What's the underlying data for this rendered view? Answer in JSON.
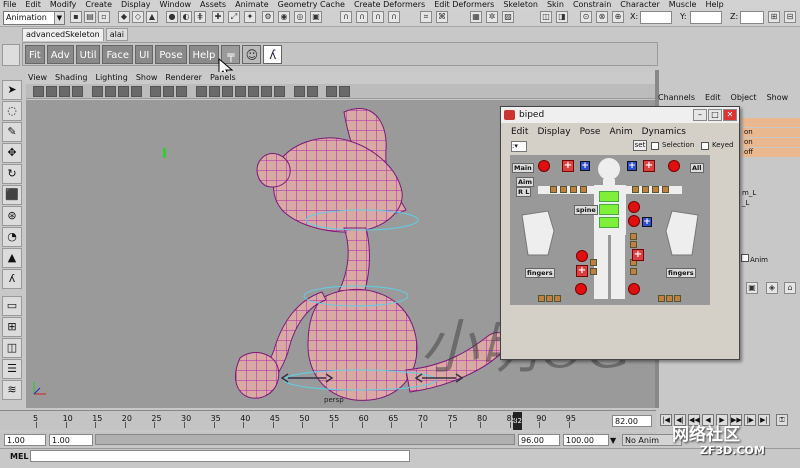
{
  "menubar": [
    "File",
    "Edit",
    "Modify",
    "Create",
    "Display",
    "Window",
    "Assets",
    "Animate",
    "Geometry Cache",
    "Create Deformers",
    "Edit Deformers",
    "Skeleton",
    "Skin",
    "Constrain",
    "Character",
    "Muscle",
    "Help"
  ],
  "mode": "Animation",
  "coords": {
    "x_label": "X:",
    "y_label": "Y:",
    "z_label": "Z:"
  },
  "shelf_tabs": [
    "advancedSkeleton",
    "alai"
  ],
  "shelf_buttons": [
    "Fit",
    "Adv",
    "Util",
    "Face",
    "UI",
    "Pose",
    "Help"
  ],
  "panel_menu": [
    "View",
    "Shading",
    "Lighting",
    "Show",
    "Renderer",
    "Panels"
  ],
  "viewport": {
    "camera_label": "persp",
    "watermark": "小明CG"
  },
  "channel_box": {
    "menu": [
      "Channels",
      "Edit",
      "Object",
      "Show"
    ],
    "values": [
      "",
      "on",
      "on",
      "off"
    ],
    "side_labels": [
      "m_L",
      "_L",
      "Anim"
    ]
  },
  "timeline": {
    "ticks": [
      "5",
      "10",
      "15",
      "20",
      "25",
      "30",
      "35",
      "40",
      "45",
      "50",
      "55",
      "60",
      "65",
      "70",
      "75",
      "80",
      "85",
      "90",
      "95"
    ],
    "current_frame": "82",
    "current_field": "82.00"
  },
  "range": {
    "start": "1.00",
    "playback_start": "1.00",
    "playback_end": "96.00",
    "end": "100.00",
    "anim_layer": "No Anim Layer"
  },
  "mel_label": "MEL",
  "biped": {
    "title": "biped",
    "menu": [
      "Edit",
      "Display",
      "Pose",
      "Anim",
      "Dynamics"
    ],
    "selector": ":",
    "set_label": "set",
    "selection_label": "Selection",
    "keyed_label": "Keyed",
    "labels": {
      "main": "Main",
      "all": "All",
      "aim": "Aim",
      "rl": "R L",
      "spine": "spine",
      "fingers_left": "fingers",
      "fingers_right": "fingers"
    }
  },
  "brand": {
    "line1": "网络社区",
    "line2": "ZF3D.COM"
  },
  "colors": {
    "accent_red": "#e01010",
    "accent_green": "#7fef3a",
    "accent_blue": "#3150c8",
    "channel_orange": "#e9b88e"
  }
}
